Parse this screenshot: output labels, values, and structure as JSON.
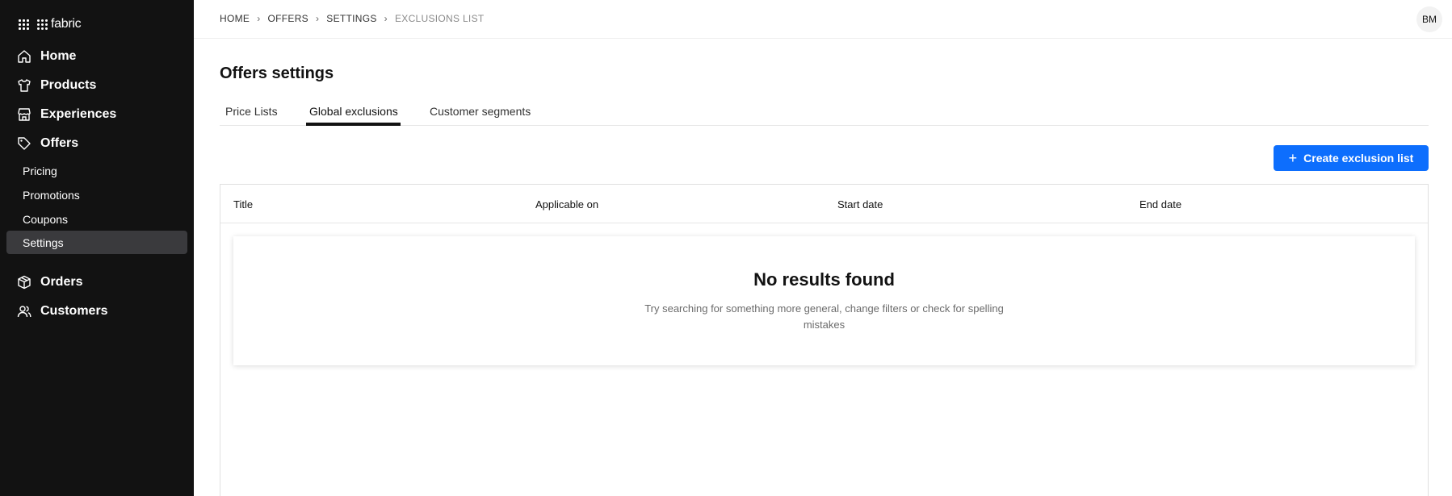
{
  "app": {
    "brand": "fabric"
  },
  "sidebar": {
    "main_items": [
      {
        "label": "Home",
        "icon": "home-icon"
      },
      {
        "label": "Products",
        "icon": "shirt-icon"
      },
      {
        "label": "Experiences",
        "icon": "storefront-icon"
      },
      {
        "label": "Offers",
        "icon": "tag-icon"
      },
      {
        "label": "Orders",
        "icon": "box-icon"
      },
      {
        "label": "Customers",
        "icon": "users-icon"
      }
    ],
    "offers_sub_items": [
      {
        "label": "Pricing"
      },
      {
        "label": "Promotions"
      },
      {
        "label": "Coupons"
      },
      {
        "label": "Settings",
        "active": true
      }
    ]
  },
  "breadcrumb": [
    "HOME",
    "OFFERS",
    "SETTINGS",
    "EXCLUSIONS LIST"
  ],
  "user": {
    "initials": "BM"
  },
  "page": {
    "title": "Offers settings"
  },
  "tabs": [
    {
      "label": "Price Lists"
    },
    {
      "label": "Global exclusions",
      "active": true
    },
    {
      "label": "Customer segments"
    }
  ],
  "actions": {
    "create_label": "Create exclusion list"
  },
  "table": {
    "columns": [
      "Title",
      "Applicable on",
      "Start date",
      "End date"
    ]
  },
  "empty_state": {
    "title": "No results found",
    "description": "Try searching for something more general, change filters or check for spelling mistakes"
  },
  "colors": {
    "sidebar_bg": "#121212",
    "accent": "#0d6efd",
    "active_item": "#3a3a3d"
  }
}
